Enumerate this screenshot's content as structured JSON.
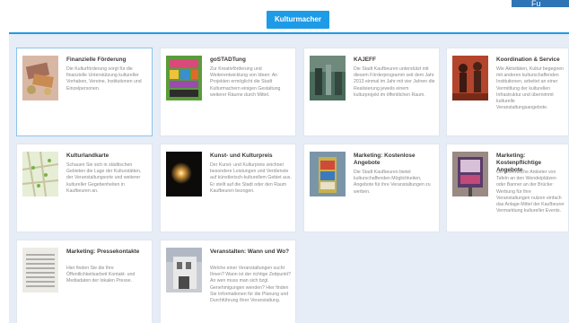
{
  "header": {
    "corner_label": "Fu",
    "active_tab": "Kulturmacher"
  },
  "cards": [
    {
      "title": "Finanzielle Förderung",
      "desc": "Die Kulturförderung sorgt für die finanzielle Unterstützung kultureller Vorhaben, Vereine, Institutionen und Einzelpersonen."
    },
    {
      "title": "goSTADTung",
      "desc": "Zur Kreativförderung und Weiterentwicklung von Ideen: An Projekten ermöglicht die Stadt Kulturmachern einigen Gestaltung weiterer Räume durch Mittel."
    },
    {
      "title": "KAJEFF",
      "desc": "Die Stadt Kaufbeuren unterstützt mit diesem Förderprogramm seit dem Jahr 2013 einmal im Jahr mit vier Jahren die Realisierung jeweils einem kulturprojekt im öffentlichen Raum."
    },
    {
      "title": "Koordination & Service",
      "desc": "Wie Aktivitäten, Kultur begegnen mit anderen kulturschaffenden Institutionen, arbeitet an einer Vermittlung der kulturellen Infrastruktur und übernimmt kulturelle Veranstaltungsangebote."
    },
    {
      "title": "Kulturlandkarte",
      "desc": "Schauen Sie sich in städtischen Gebieten die Lage der Kulturstätten, der Veranstaltungsorte und weiterer kultureller Gegebenheiten in Kaufbeuren an."
    },
    {
      "title": "Kunst- und Kulturpreis",
      "desc": "Der Kunst- und Kulturpreis zeichnet besondere Leistungen und Verdienste auf künstlerisch-kulturellem Gebiet aus. Er stellt auf die Stadt oder den Raum Kaufbeuren bezogen."
    },
    {
      "title": "Marketing: Kostenlose Angebote",
      "desc": "Die Stadt Kaufbeuren bietet kulturschaffenden Möglichkeiten, Angebote für ihre Veranstaltungen zu werben."
    },
    {
      "title": "Marketing: Kostenpflichtige Angebote",
      "desc": "Ob gewerbliche Anbieter von Tafeln an den Wendelplätzen oder Banner an der Brücke: Werbung für Ihre Veranstaltungen nutzen einfach das Anlage-Mittel der Kaufbeurer Vermarktung kultureller Events."
    },
    {
      "title": "Marketing: Pressekontakte",
      "desc": "Hier finden Sie die Ihre Öffentlichkeitsarbeit Kontakt- und Mediadaten der lokalen Presse."
    },
    {
      "title": "Veranstalten: Wann und Wo?",
      "desc": "Welche einer Veranstaltungen sucht Ihnen? Wann ist der richtige Zeitpunkt? An wen muss man sich bzgl. Genehmigungen wenden? Hier finden Sie Informationen für die Planung und Durchführung Ihrer Veranstaltung."
    }
  ]
}
